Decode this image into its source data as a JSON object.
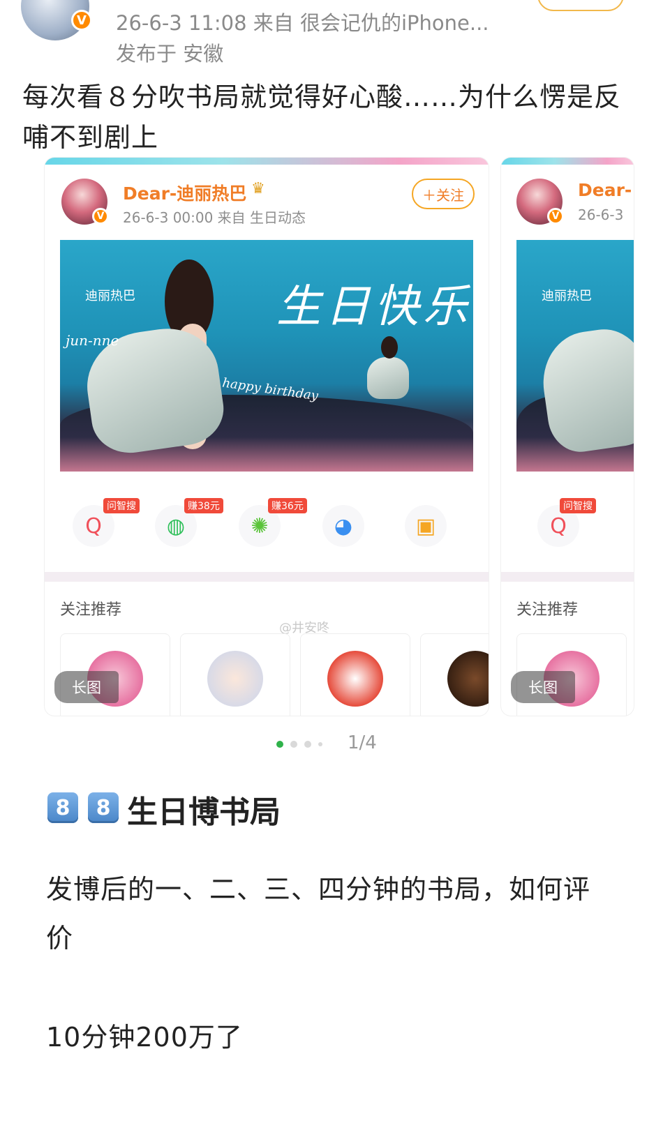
{
  "post": {
    "meta_line1": "26-6-3 11:08   来自 很会记仇的iPhone...",
    "meta_line2": "发布于 安徽",
    "text": "每次看８分吹书局就觉得好心酸……为什么愣是反哺不到剧上",
    "verified_badge": "V"
  },
  "embedded_post": {
    "author": "Dear-迪丽热巴",
    "author_truncated": "Dear-",
    "meta": "26-6-3 00:00  来自 生日动态",
    "meta_truncated": "26-6-3",
    "follow_label": "＋关注",
    "poster": {
      "title": "生日快乐",
      "brand": "迪丽热巴",
      "script_left": "jun-nne",
      "script_mid": "happy birthday"
    },
    "share_icons": [
      {
        "name": "search-share-icon",
        "glyph": "Q",
        "tag": "问智搜",
        "color": "#f0505a"
      },
      {
        "name": "wechat-icon",
        "glyph": "◍",
        "tag": "赚38元",
        "color": "#2fbf5a"
      },
      {
        "name": "moments-icon",
        "glyph": "✺",
        "tag": "赚36元",
        "color": "#5ac43a"
      },
      {
        "name": "qq-icon",
        "glyph": "◕",
        "tag": "",
        "color": "#3a8ff0"
      },
      {
        "name": "save-image-icon",
        "glyph": "▣",
        "tag": "",
        "color": "#f5a623"
      }
    ],
    "recommend_title": "关注推荐",
    "long_image_label": "长图",
    "watermark": "@井安咚"
  },
  "pager": {
    "label": "1/4"
  },
  "article": {
    "title_keycaps": [
      "8",
      "8"
    ],
    "title": "生日博书局",
    "para1": "发博后的一、二、三、四分钟的书局，如何评价",
    "para2": "10分钟200万了"
  },
  "colors": {
    "accent_orange": "#f07d27",
    "pager_active": "#2fb24a"
  }
}
